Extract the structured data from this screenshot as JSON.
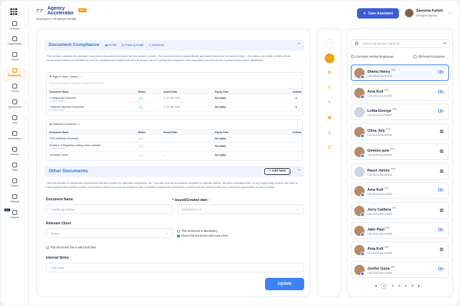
{
  "brand": {
    "name_line1": "Agency",
    "name_line2": "Accelerator",
    "badge": "Pro"
  },
  "breadcrumb": "Employees  >  Employee Details",
  "header": {
    "assistant_label": "Care Assistant",
    "user_name": "Sareena Fahim",
    "user_org": "Glasgow Agency"
  },
  "nav": [
    {
      "label": "Overview",
      "chevron": true
    },
    {
      "label": "Organisation",
      "chevron": false
    },
    {
      "label": "Clients",
      "chevron": true
    },
    {
      "label": "Employees",
      "chevron": true,
      "active": true
    },
    {
      "label": "Leaves",
      "chevron": false
    },
    {
      "label": "Agreements",
      "chevron": true
    },
    {
      "label": "Jobs",
      "chevron": true
    },
    {
      "label": "Marketplace",
      "chevron": false
    },
    {
      "label": "Finance",
      "chevron": true
    },
    {
      "label": "Tasks",
      "chevron": true
    },
    {
      "label": "Payroll",
      "chevron": false
    },
    {
      "label": "Settings",
      "chevron": false
    },
    {
      "label": "Reports",
      "chevron": false,
      "badge": "Pro"
    }
  ],
  "compliance": {
    "title": "Document Compliance",
    "tabs": [
      "Profile",
      "Training Guide",
      "Summary"
    ],
    "description": "This section contains the standard compliance documents required for this worker's profile. The document list is automatically generated based on the worker's type, visa status, and other profile criteria. Documents marked as Mandatory must be uploaded and verified before this worker can be considered compliant. Non-mandatory documents are recommended where applicable.",
    "rtw": {
      "heading": "Right to Work Checks",
      "count": "(1)",
      "note": "Documents required for verification of right to work in the UK",
      "columns": [
        "Document Name",
        "Status",
        "Issued Date",
        "Expiry Date",
        "Actions"
      ],
      "rows": [
        {
          "name": "* Passport/ID Document",
          "sub": "1 Visible Upload",
          "issued": "21 Jan 2024",
          "expiry": "No expiry"
        },
        {
          "name": "* National Insurance Document",
          "sub": "1 Visible Upload",
          "issued": "21 Jan 2024",
          "expiry": "No expiry"
        }
      ]
    },
    "optional": {
      "heading": "Optional Documents",
      "count": "(3)",
      "columns": [
        "Document Name",
        "Status",
        "Issued Date",
        "Expiry Date",
        "Actions"
      ],
      "rows": [
        {
          "name": "PVG Certificate (Scotland)",
          "sub": "",
          "issued": "—",
          "expiry": "No expiry"
        },
        {
          "name": "Evidence of Regulatory Setting where selected",
          "sub": "1 Visible Upload",
          "issued": "—",
          "expiry": "No expiry"
        },
        {
          "name": "Overseas Check",
          "sub": "",
          "issued": "—",
          "expiry": "No expiry"
        }
      ]
    }
  },
  "other": {
    "title": "Other Documents",
    "add_label": "+ Add New",
    "description": "Use this section to upload any documents that fall outside the standard compliance list. This may include documents required by specific clients, off-panel arrangements, or any supporting records you wish to store against this worker's profile. Documents added here are not subject to the CoreHires compliance verification process and are stored purely as a reference against this worker's profile.",
    "doc_name_label": "Document Name",
    "doc_name_placeholder": "Certificate Name",
    "date_label": "Issued/Created date",
    "date_placeholder": "DD/MM/YYYY",
    "client_label": "Relevant Client",
    "client_placeholder": "Select",
    "mandatory_label": "This document is Mandatory",
    "share_label": "Share this document with Care Hires",
    "valid_until_label": "This document has a valid until date",
    "notes_label": "Internal Notes",
    "notes_placeholder": "Add Note",
    "update_label": "Update"
  },
  "workers": {
    "search_placeholder": "Search by Worker name/ID",
    "filter_verified": "CoreHires Verified Employees",
    "filter_offpanel": "Off-Panel Employees",
    "list": [
      {
        "name": "Shenu Henry",
        "tag": "(He)",
        "id": "CW-2024-AA-01755",
        "selected": true,
        "verified": true,
        "kind": "logo"
      },
      {
        "name": "Ama Koli",
        "tag": "(He)",
        "id": "CW-2024-AA-01552",
        "verified": true,
        "kind": "logo"
      },
      {
        "name": "Lolita George",
        "tag": "(He)",
        "id": "CW-2024-AA-01537",
        "verified": false,
        "kind": "logo"
      },
      {
        "name": "Olina July",
        "tag": "(He)",
        "id": "CW-2024-AA-01534",
        "verified": true,
        "kind": "building"
      },
      {
        "name": "Ginnies jane",
        "tag": "(He)",
        "id": "CW-2024-AA-01522",
        "verified": true,
        "kind": "building"
      },
      {
        "name": "Rasel James",
        "tag": "(He)",
        "id": "CW-2024-AA-00002",
        "verified": false,
        "kind": "building"
      },
      {
        "name": "Ama Koli",
        "tag": "(He)",
        "id": "CW-2024-AA-01552",
        "verified": true,
        "kind": "logo"
      },
      {
        "name": "Jerry Caldera",
        "tag": "(He)",
        "id": "CW-2024-AA-01600",
        "verified": true,
        "kind": "building"
      },
      {
        "name": "Jake Paul",
        "tag": "(He)",
        "id": "CW-2024-AA-01600",
        "verified": true,
        "kind": "logo"
      },
      {
        "name": "Ama Koli",
        "tag": "(He)",
        "id": "CW-2024-AA-01552",
        "verified": true,
        "kind": "building"
      },
      {
        "name": "Jenifer Gana",
        "tag": "(He)",
        "id": "CW-2024-AA-01600",
        "verified": true,
        "kind": "logo"
      }
    ],
    "pages": [
      "1",
      "2",
      "3",
      "4",
      "5"
    ],
    "current_page": "1"
  },
  "side_tools": [
    "info-icon",
    "folder-icon",
    "document-icon",
    "phone-icon",
    "pen-icon",
    "briefcase-icon",
    "pound-icon",
    "list-icon"
  ]
}
